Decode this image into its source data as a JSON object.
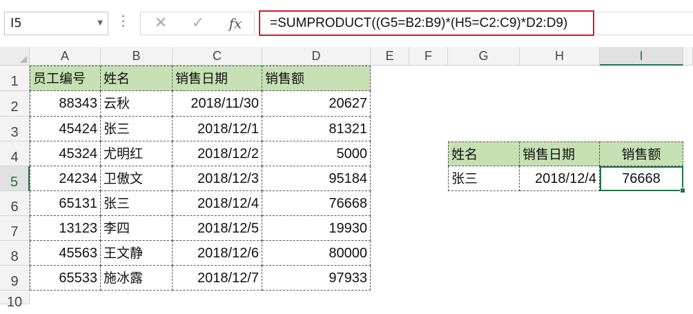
{
  "formula_bar": {
    "name_box": "I5",
    "formula": "=SUMPRODUCT((G5=B2:B9)*(H5=C2:C9)*D2:D9)"
  },
  "columns": [
    "A",
    "B",
    "C",
    "D",
    "E",
    "F",
    "G",
    "H",
    "I"
  ],
  "rows": [
    "1",
    "2",
    "3",
    "4",
    "5",
    "6",
    "7",
    "8",
    "9",
    "10"
  ],
  "main_table": {
    "headers": [
      "员工编号",
      "姓名",
      "销售日期",
      "销售额"
    ],
    "rows": [
      [
        "88343",
        "云秋",
        "2018/11/30",
        "20627"
      ],
      [
        "45424",
        "张三",
        "2018/12/1",
        "81321"
      ],
      [
        "45324",
        "尤明红",
        "2018/12/2",
        "5000"
      ],
      [
        "24234",
        "卫傲文",
        "2018/12/3",
        "95184"
      ],
      [
        "65131",
        "张三",
        "2018/12/4",
        "76668"
      ],
      [
        "13123",
        "李四",
        "2018/12/5",
        "19930"
      ],
      [
        "45563",
        "王文静",
        "2018/12/6",
        "80000"
      ],
      [
        "65533",
        "施冰露",
        "2018/12/7",
        "97933"
      ]
    ]
  },
  "lookup_table": {
    "headers": [
      "姓名",
      "销售日期",
      "销售额"
    ],
    "values": [
      "张三",
      "2018/12/4",
      "76668"
    ]
  },
  "colors": {
    "header_fill": "#c6e0b4",
    "selection": "#217346",
    "formula_outline": "#e0141e"
  }
}
